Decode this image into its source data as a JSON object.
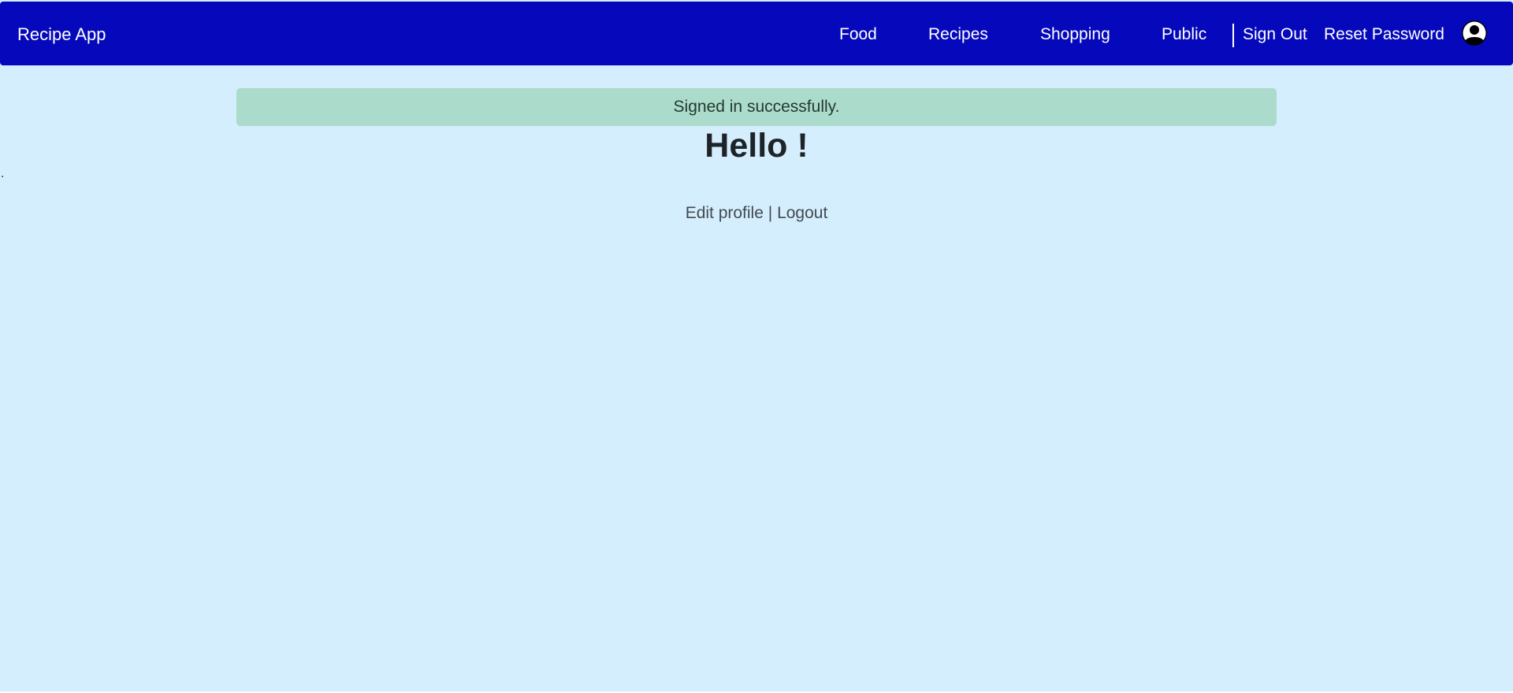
{
  "navbar": {
    "brand": "Recipe App",
    "links": [
      {
        "label": "Food"
      },
      {
        "label": "Recipes"
      },
      {
        "label": "Shopping"
      },
      {
        "label": "Public"
      }
    ],
    "auth_links": [
      {
        "label": "Sign Out"
      },
      {
        "label": "Reset Password"
      }
    ],
    "avatar_icon": "user-avatar-icon"
  },
  "flash": {
    "message": "Signed in successfully."
  },
  "main": {
    "greeting": "Hello !",
    "stray_text": ".",
    "edit_profile": "Edit profile",
    "separator": "|",
    "logout": "Logout"
  },
  "colors": {
    "navbar": "#0509bb",
    "page_background": "#d4eefd",
    "flash_background": "#abdbcb",
    "nav_text": "#ffffff"
  }
}
